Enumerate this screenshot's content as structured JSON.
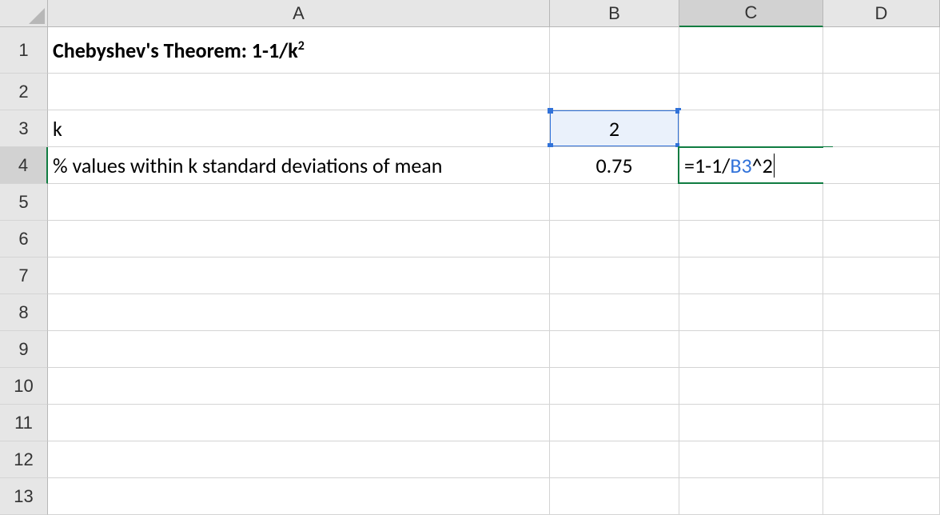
{
  "columns": {
    "A": "A",
    "B": "B",
    "C": "C",
    "D": "D"
  },
  "rows": {
    "r1": "1",
    "r2": "2",
    "r3": "3",
    "r4": "4",
    "r5": "5",
    "r6": "6",
    "r7": "7",
    "r8": "8",
    "r9": "9",
    "r10": "10",
    "r11": "11",
    "r12": "12",
    "r13": "13"
  },
  "cells": {
    "A1_prefix": "Chebyshev's Theorem: 1-1/k",
    "A1_sup": "2",
    "A3": "k",
    "A4": "% values within k standard deviations of mean",
    "B3": "2",
    "B4": "0.75",
    "C4_formula_pre": "=1-1/",
    "C4_formula_ref": "B3",
    "C4_formula_post": "^2"
  },
  "active": {
    "col": "C",
    "row": "4",
    "referenced": "B3"
  }
}
